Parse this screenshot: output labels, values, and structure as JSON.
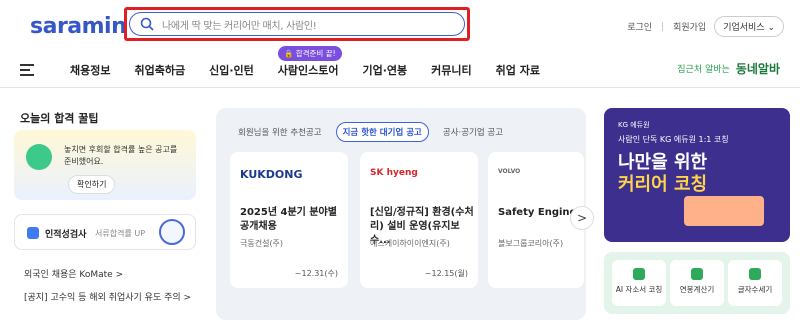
{
  "header": {
    "logo": "saramin",
    "search": {
      "placeholder": "나에게 딱 맞는 커리어만 매치, 사람인!"
    },
    "links": [
      "로그인",
      "회원가입"
    ],
    "biz_button": "기업서비스 ⌄"
  },
  "nav": {
    "items": [
      "채용정보",
      "취업축하금",
      "신입·인턴",
      "사람인스토어",
      "기업·연봉",
      "커뮤니티",
      "취업 자료"
    ],
    "badge": "🔒 합격준비 끝!",
    "right_caption": "집근처 알바는",
    "right_brand": "동네알바"
  },
  "left": {
    "title": "오늘의 합격 꿀팁",
    "tip_text": "놓치면 후회할 합격률 높은 공고를 준비했어요.",
    "tip_button": "확인하기",
    "aptitude_label": "인적성검사",
    "aptitude_sub": "서류합격률 UP",
    "line1": "외국인 채용은 KoMate >",
    "line2": "[공지] 고수익 등 해외 취업사기 유도 주의 >"
  },
  "center": {
    "tabs": [
      "회원님을 위한 추천공고",
      "지금 핫한 대기업 공고",
      "공사·공기업 공고"
    ],
    "jobs": [
      {
        "logo": "KUKDONG",
        "title": "2025년 4분기 분야별 공개채용",
        "company": "극동건설(주)",
        "date": "~12.31(수)"
      },
      {
        "logo": "SK hyeng",
        "title": "[신입/정규직] 환경(수처리) 설비 운영(유지보수...",
        "company": "에스케이하이이엔지(주)",
        "date": "~12.15(월)"
      },
      {
        "logo": "VOLVO",
        "title": "Safety Engineer",
        "company": "볼보그룹코리아(주)",
        "date": ""
      }
    ],
    "next_arrow": ">"
  },
  "right": {
    "banner_brand": "KG 에듀원",
    "banner_sub": "사람인 단독 KG 에듀원 1:1 코칭",
    "banner_line1": "나만을 위한",
    "banner_line2": "커리어 코칭",
    "tools": [
      "AI 자소서 코칭",
      "연봉계산기",
      "글자수세기"
    ]
  }
}
